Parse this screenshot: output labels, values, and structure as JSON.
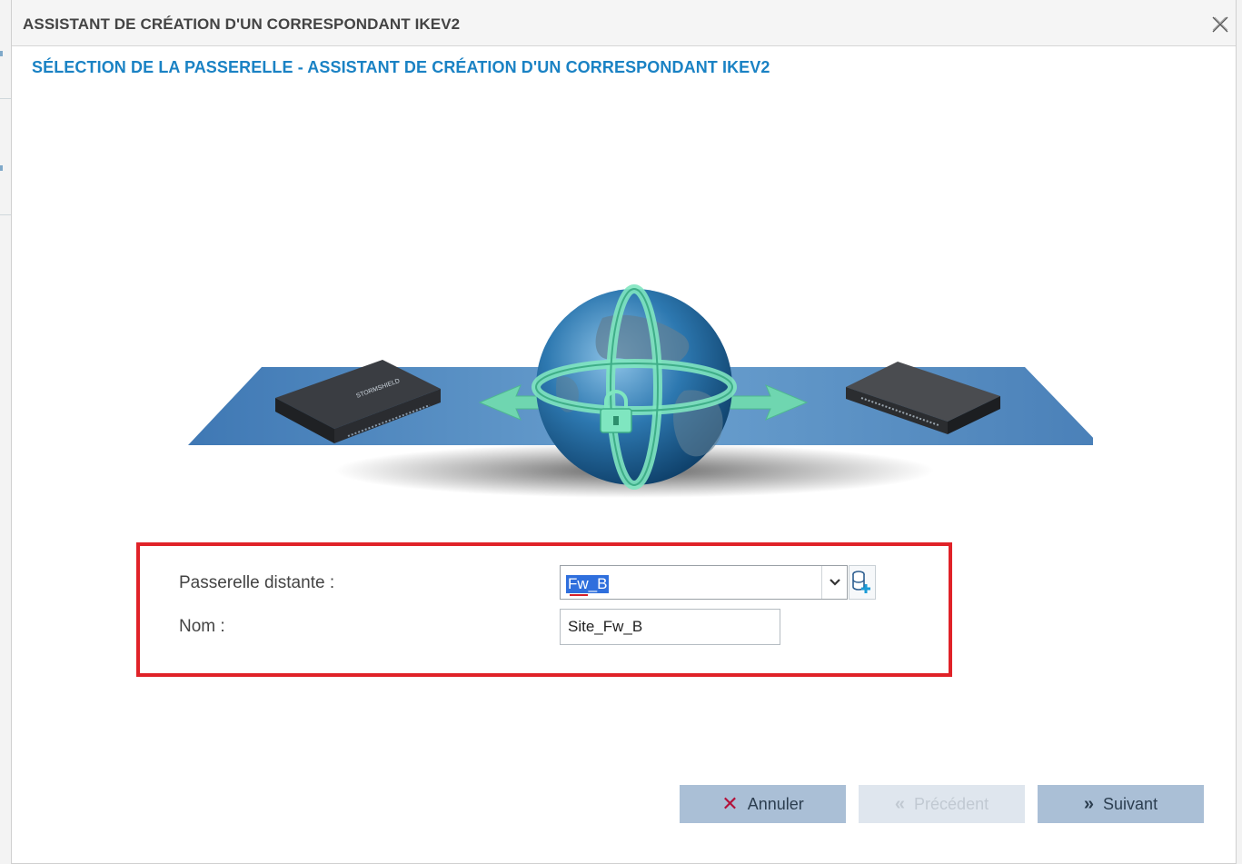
{
  "dialog": {
    "title": "ASSISTANT DE CRÉATION D'UN CORRESPONDANT IKEV2",
    "subtitle": "SÉLECTION DE LA PASSERELLE - ASSISTANT DE CRÉATION D'UN CORRESPONDANT IKEV2"
  },
  "illustration": {
    "left_device_brand": "STORMSHIELD",
    "center": "globe-lock-icon"
  },
  "form": {
    "remote_gateway_label": "Passerelle distante :",
    "remote_gateway_value": "Fw_B",
    "name_label": "Nom :",
    "name_value": "Site_Fw_B"
  },
  "buttons": {
    "cancel": "Annuler",
    "previous": "Précédent",
    "next": "Suivant"
  },
  "colors": {
    "accent": "#1a82c4",
    "highlight_border": "#e02228",
    "button_bg": "#aabfd6"
  }
}
